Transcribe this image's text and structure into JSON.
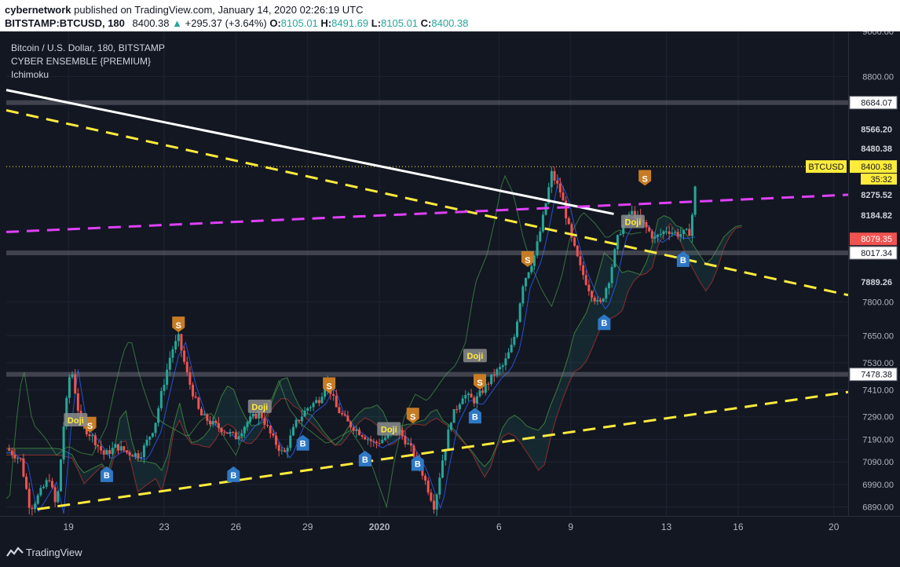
{
  "header": {
    "username": "cybernetwork",
    "published_text": "published on TradingView.com, January 14, 2020 02:26:19 UTC",
    "symbol_line": "BITSTAMP:BTCUSD, 180",
    "last_price": "8400.38",
    "change": "+295.37 (+3.64%)",
    "open_label": "O:",
    "open": "8105.01",
    "high_label": "H:",
    "high": "8491.69",
    "low_label": "L:",
    "low": "8105.01",
    "close_label": "C:",
    "close": "8400.38"
  },
  "legend": {
    "title": "Bitcoin / U.S. Dollar, 180, BITSTAMP",
    "indicator_1": "CYBER ENSEMBLE {PREMIUM}",
    "indicator_2": "Ichimoku"
  },
  "footer": {
    "brand": "TradingView"
  },
  "colors": {
    "background": "#131722",
    "up": "#26a69a",
    "down": "#ef5350",
    "trend_white": "#ffffff",
    "trend_yellow": "#ffeb3b",
    "trend_magenta": "#e040fb",
    "sell_marker": "#c77c24",
    "buy_marker": "#2e78c5",
    "current_price": "#ffeb3b"
  },
  "chart_data": {
    "type": "candlestick",
    "symbol": "BTCUSD",
    "timeframe": "180",
    "y_range": [
      6850,
      9000
    ],
    "y_ticks": [
      9000.0,
      8800.0,
      7800.0,
      7650.0,
      7530.0,
      7410.0,
      7290.0,
      7190.0,
      7090.0,
      6990.0,
      6890.0
    ],
    "x_ticks": [
      {
        "label": "19",
        "t": 19
      },
      {
        "label": "23",
        "t": 23
      },
      {
        "label": "26",
        "t": 26
      },
      {
        "label": "29",
        "t": 29
      },
      {
        "label": "2020",
        "t": 32
      },
      {
        "label": "6",
        "t": 37
      },
      {
        "label": "9",
        "t": 40
      },
      {
        "label": "13",
        "t": 44
      },
      {
        "label": "16",
        "t": 47
      },
      {
        "label": "20",
        "t": 51
      }
    ],
    "x_range": [
      16.4,
      51.6
    ],
    "price_badges": [
      {
        "value": "8684.07",
        "price": 8684.07,
        "kind": "level"
      },
      {
        "value": "8566.20",
        "price": 8566.2,
        "kind": "plain"
      },
      {
        "value": "8480.38",
        "price": 8480.38,
        "kind": "plain"
      },
      {
        "value": "8400.38",
        "price": 8400.38,
        "kind": "current"
      },
      {
        "value": "8275.52",
        "price": 8275.52,
        "kind": "plain"
      },
      {
        "value": "8184.82",
        "price": 8184.82,
        "kind": "plain"
      },
      {
        "value": "8079.35",
        "price": 8079.35,
        "kind": "red"
      },
      {
        "value": "8017.34",
        "price": 8017.34,
        "kind": "level"
      },
      {
        "value": "7889.26",
        "price": 7889.26,
        "kind": "plain"
      },
      {
        "value": "7478.38",
        "price": 7478.38,
        "kind": "level"
      }
    ],
    "current_symbol_label": "BTCUSD",
    "countdown": "35:32",
    "horizontal_levels": [
      8684.07,
      8017.34,
      7478.38
    ],
    "trendlines": [
      {
        "color": "#ffffff",
        "style": "solid",
        "points": [
          [
            16.4,
            8740
          ],
          [
            41.8,
            8190
          ]
        ]
      },
      {
        "color": "#ffeb3b",
        "style": "dashed",
        "points": [
          [
            16.4,
            8650
          ],
          [
            51.6,
            7830
          ]
        ]
      },
      {
        "color": "#ffeb3b",
        "style": "dashed",
        "points": [
          [
            17.7,
            6880
          ],
          [
            51.6,
            7400
          ]
        ]
      },
      {
        "color": "#e040fb",
        "style": "dashed",
        "points": [
          [
            16.4,
            8110
          ],
          [
            51.6,
            8275
          ]
        ]
      }
    ],
    "markers": [
      {
        "type": "S",
        "t": 19.9,
        "price": 7255
      },
      {
        "type": "S",
        "t": 23.6,
        "price": 7700
      },
      {
        "type": "S",
        "t": 29.9,
        "price": 7430
      },
      {
        "type": "S",
        "t": 33.4,
        "price": 7295
      },
      {
        "type": "S",
        "t": 36.2,
        "price": 7445
      },
      {
        "type": "S",
        "t": 38.2,
        "price": 7990
      },
      {
        "type": "S",
        "t": 43.1,
        "price": 8350
      },
      {
        "type": "B",
        "t": 20.6,
        "price": 7035
      },
      {
        "type": "B",
        "t": 25.9,
        "price": 7035
      },
      {
        "type": "B",
        "t": 28.8,
        "price": 7175
      },
      {
        "type": "B",
        "t": 31.4,
        "price": 7105
      },
      {
        "type": "B",
        "t": 33.6,
        "price": 7085
      },
      {
        "type": "B",
        "t": 36.0,
        "price": 7295
      },
      {
        "type": "B",
        "t": 41.4,
        "price": 7710
      },
      {
        "type": "B",
        "t": 44.7,
        "price": 7990
      }
    ],
    "doji": [
      {
        "label": "Doji",
        "t": 19.3,
        "price": 7275
      },
      {
        "label": "Doji",
        "t": 27.0,
        "price": 7335
      },
      {
        "label": "Doji",
        "t": 32.4,
        "price": 7235
      },
      {
        "label": "Doji",
        "t": 36.0,
        "price": 7560
      },
      {
        "label": "Doji",
        "t": 42.6,
        "price": 8155
      }
    ],
    "path": [
      [
        16.4,
        7150
      ],
      [
        17.0,
        7100
      ],
      [
        17.4,
        6880
      ],
      [
        17.8,
        6950
      ],
      [
        18.2,
        7020
      ],
      [
        18.5,
        6880
      ],
      [
        18.8,
        7250
      ],
      [
        19.1,
        7520
      ],
      [
        19.5,
        7260
      ],
      [
        20.0,
        7200
      ],
      [
        20.5,
        7120
      ],
      [
        21.0,
        7160
      ],
      [
        21.5,
        7130
      ],
      [
        22.0,
        7120
      ],
      [
        22.6,
        7250
      ],
      [
        22.9,
        7400
      ],
      [
        23.3,
        7580
      ],
      [
        23.6,
        7640
      ],
      [
        24.0,
        7460
      ],
      [
        24.5,
        7300
      ],
      [
        25.0,
        7260
      ],
      [
        25.5,
        7230
      ],
      [
        26.0,
        7200
      ],
      [
        26.5,
        7270
      ],
      [
        27.0,
        7310
      ],
      [
        27.5,
        7200
      ],
      [
        28.0,
        7120
      ],
      [
        28.5,
        7260
      ],
      [
        29.0,
        7330
      ],
      [
        29.5,
        7370
      ],
      [
        29.8,
        7450
      ],
      [
        30.2,
        7330
      ],
      [
        30.7,
        7260
      ],
      [
        31.2,
        7220
      ],
      [
        31.8,
        7170
      ],
      [
        32.3,
        7200
      ],
      [
        32.8,
        7230
      ],
      [
        33.3,
        7150
      ],
      [
        33.7,
        7070
      ],
      [
        34.0,
        6980
      ],
      [
        34.3,
        6890
      ],
      [
        34.6,
        7080
      ],
      [
        35.0,
        7280
      ],
      [
        35.5,
        7390
      ],
      [
        36.0,
        7360
      ],
      [
        36.4,
        7420
      ],
      [
        36.8,
        7480
      ],
      [
        37.2,
        7520
      ],
      [
        37.6,
        7620
      ],
      [
        38.0,
        7880
      ],
      [
        38.5,
        8010
      ],
      [
        38.8,
        8150
      ],
      [
        39.2,
        8370
      ],
      [
        39.6,
        8280
      ],
      [
        40.0,
        8090
      ],
      [
        40.4,
        7950
      ],
      [
        40.8,
        7850
      ],
      [
        41.2,
        7780
      ],
      [
        41.6,
        7900
      ],
      [
        42.0,
        8100
      ],
      [
        42.5,
        8200
      ],
      [
        43.0,
        8150
      ],
      [
        43.5,
        8080
      ],
      [
        44.0,
        8120
      ],
      [
        44.5,
        8100
      ],
      [
        45.0,
        8110
      ],
      [
        45.3,
        8400
      ]
    ]
  }
}
